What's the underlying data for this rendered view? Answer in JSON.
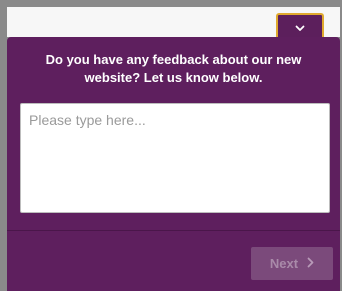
{
  "widget": {
    "question": "Do you have any feedback about our new website? Let us know below.",
    "input_placeholder": "Please type here...",
    "input_value": "",
    "next_label": "Next",
    "toggle_icon": "chevron-down-icon",
    "next_icon": "chevron-right-icon"
  },
  "colors": {
    "panel": "#5e1f5e",
    "accent_border": "#e0a92e",
    "button_disabled": "#7b4a7b",
    "button_text_disabled": "#a98aa9"
  }
}
